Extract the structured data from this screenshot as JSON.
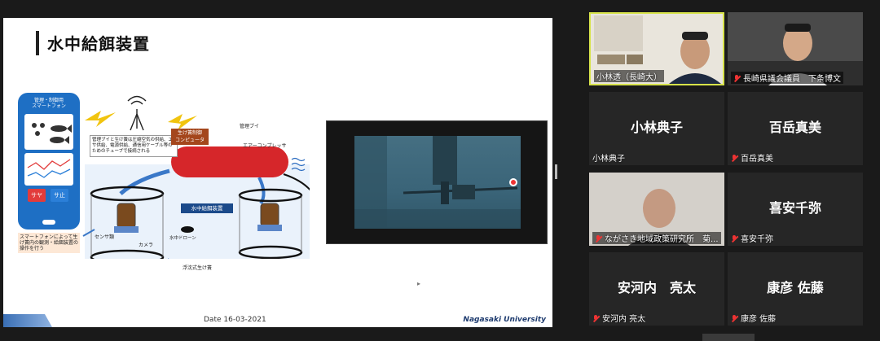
{
  "slide": {
    "title": "水中給餌装置",
    "date": "Date 16-03-2021",
    "university": "Nagasaki University"
  },
  "diagram": {
    "phone_title": "管理・制御用\nスマートフォン",
    "phone_btn_left": "サヤ",
    "phone_btn_right": "サ止",
    "phone_caption": "スマートフォンによって生け簀内の観測・給餌装置の操作を行う",
    "buoy_note": "管理ブイと生け簀は圧縮空気の供給、エサ供給、電源供給、通信用ケーブル等のためのチューブで接続される",
    "controller_label": "生け簀制御\nコンピュータ",
    "buoy_label": "管理ブイ",
    "air_compressor_label": "エアーコンプレッサ",
    "device_label": "水中給餌装置",
    "sensor_label": "センサ類",
    "camera_label": "カメラ",
    "drone_label": "水中ドローン",
    "cage_label": "浮沈式生け簀"
  },
  "participants": [
    {
      "name_tag": "小林透（長崎大）",
      "display": "",
      "muted": false,
      "video": true,
      "active": true
    },
    {
      "name_tag": "長崎県議会議員　下条博文",
      "display": "",
      "muted": true,
      "video": true,
      "active": false
    },
    {
      "name_tag": "小林典子",
      "display": "小林典子",
      "muted": false,
      "video": false,
      "active": false
    },
    {
      "name_tag": "百岳真美",
      "display": "百岳真美",
      "muted": true,
      "video": false,
      "active": false
    },
    {
      "name_tag": "ながさき地域政策研究所　菊...",
      "display": "",
      "muted": true,
      "video": true,
      "active": false
    },
    {
      "name_tag": "喜安千弥",
      "display": "喜安千弥",
      "muted": true,
      "video": false,
      "active": false
    },
    {
      "name_tag": "安河内 亮太",
      "display": "安河内　亮太",
      "muted": true,
      "video": false,
      "active": false
    },
    {
      "name_tag": "康彦 佐藤",
      "display": "康彦 佐藤",
      "muted": true,
      "video": false,
      "active": false
    }
  ]
}
